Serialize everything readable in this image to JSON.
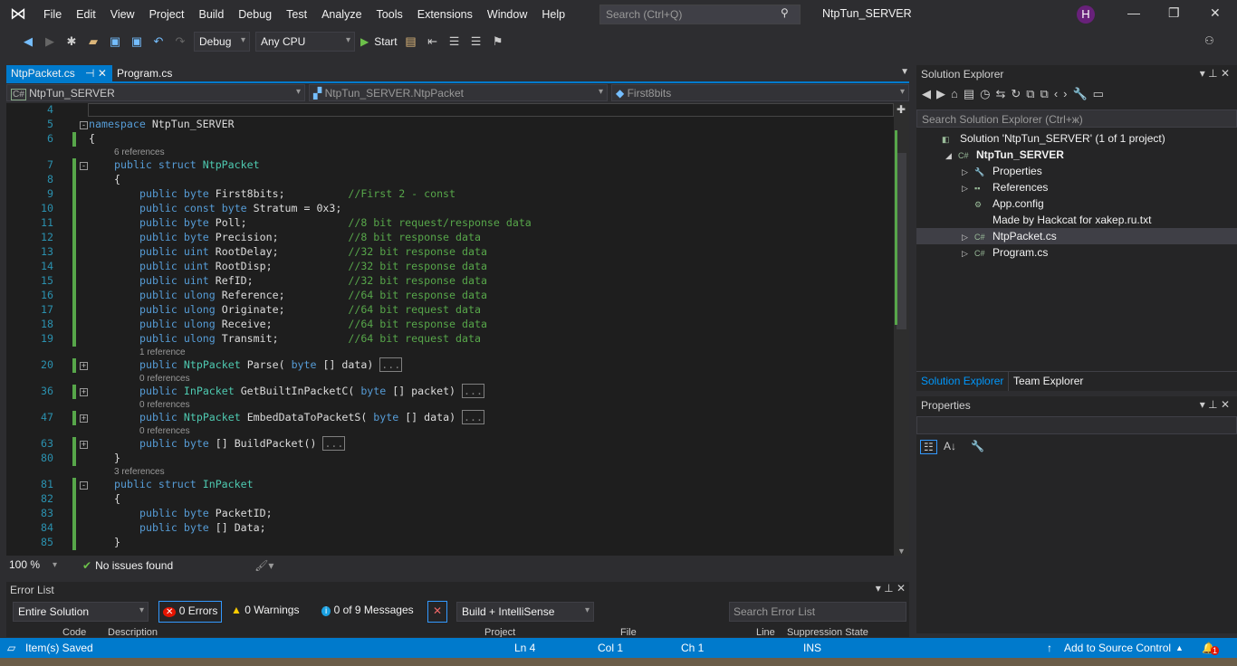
{
  "menu": {
    "items": [
      "File",
      "Edit",
      "View",
      "Project",
      "Build",
      "Debug",
      "Test",
      "Analyze",
      "Tools",
      "Extensions",
      "Window",
      "Help"
    ],
    "search_placeholder": "Search (Ctrl+Q)",
    "solution_title": "NtpTun_SERVER",
    "avatar": "H"
  },
  "toolbar": {
    "config": "Debug",
    "platform": "Any CPU",
    "start": "Start"
  },
  "tabs": [
    {
      "label": "NtpPacket.cs",
      "active": true
    },
    {
      "label": "Program.cs",
      "active": false
    }
  ],
  "navbar": {
    "project": "NtpTun_SERVER",
    "type": "NtpTun_SERVER.NtpPacket",
    "member": "First8bits"
  },
  "code": [
    {
      "n": "4",
      "i": 0,
      "t": []
    },
    {
      "n": "5",
      "i": 0,
      "fold": "-",
      "t": [
        [
          "kw",
          "namespace"
        ],
        [
          "",
          "NtpTun_SERVER"
        ]
      ]
    },
    {
      "n": "6",
      "i": 0,
      "t": [
        [
          "",
          "{"
        ]
      ]
    },
    {
      "lens": "6 references",
      "i": 1
    },
    {
      "n": "7",
      "i": 1,
      "fold": "-",
      "t": [
        [
          "kw",
          "public struct"
        ],
        [
          "ty",
          "NtpPacket"
        ]
      ]
    },
    {
      "n": "8",
      "i": 1,
      "t": [
        [
          "",
          "{"
        ]
      ]
    },
    {
      "n": "9",
      "i": 2,
      "t": [
        [
          "kw",
          "public byte"
        ],
        [
          "",
          "First8bits;         "
        ],
        [
          "cm",
          "//First 2 - const"
        ]
      ]
    },
    {
      "n": "10",
      "i": 2,
      "t": [
        [
          "kw",
          "public const byte"
        ],
        [
          "",
          "Stratum = 0x3;"
        ]
      ]
    },
    {
      "n": "11",
      "i": 2,
      "t": [
        [
          "kw",
          "public byte"
        ],
        [
          "",
          "Poll;               "
        ],
        [
          "cm",
          "//8 bit request/response data"
        ]
      ]
    },
    {
      "n": "12",
      "i": 2,
      "t": [
        [
          "kw",
          "public byte"
        ],
        [
          "",
          "Precision;          "
        ],
        [
          "cm",
          "//8 bit response data"
        ]
      ]
    },
    {
      "n": "13",
      "i": 2,
      "t": [
        [
          "kw",
          "public uint"
        ],
        [
          "",
          "RootDelay;          "
        ],
        [
          "cm",
          "//32 bit response data"
        ]
      ]
    },
    {
      "n": "14",
      "i": 2,
      "t": [
        [
          "kw",
          "public uint"
        ],
        [
          "",
          "RootDisp;           "
        ],
        [
          "cm",
          "//32 bit response data"
        ]
      ]
    },
    {
      "n": "15",
      "i": 2,
      "t": [
        [
          "kw",
          "public uint"
        ],
        [
          "",
          "RefID;              "
        ],
        [
          "cm",
          "//32 bit response data"
        ]
      ]
    },
    {
      "n": "16",
      "i": 2,
      "t": [
        [
          "kw",
          "public ulong"
        ],
        [
          "",
          "Reference;         "
        ],
        [
          "cm",
          "//64 bit response data"
        ]
      ]
    },
    {
      "n": "17",
      "i": 2,
      "t": [
        [
          "kw",
          "public ulong"
        ],
        [
          "",
          "Originate;         "
        ],
        [
          "cm",
          "//64 bit request data"
        ]
      ]
    },
    {
      "n": "18",
      "i": 2,
      "t": [
        [
          "kw",
          "public ulong"
        ],
        [
          "",
          "Receive;           "
        ],
        [
          "cm",
          "//64 bit response data"
        ]
      ]
    },
    {
      "n": "19",
      "i": 2,
      "t": [
        [
          "kw",
          "public ulong"
        ],
        [
          "",
          "Transmit;          "
        ],
        [
          "cm",
          "//64 bit request data"
        ]
      ]
    },
    {
      "lens": "1 reference",
      "i": 2
    },
    {
      "n": "20",
      "i": 2,
      "fold": "+",
      "t": [
        [
          "kw",
          "public"
        ],
        [
          "ty",
          "NtpPacket"
        ],
        [
          "",
          "Parse("
        ],
        [
          "kw",
          "byte"
        ],
        [
          "",
          "[] data)"
        ],
        [
          "col",
          "..."
        ]
      ]
    },
    {
      "lens": "0 references",
      "i": 2
    },
    {
      "n": "36",
      "i": 2,
      "fold": "+",
      "t": [
        [
          "kw",
          "public"
        ],
        [
          "ty",
          "InPacket"
        ],
        [
          "",
          "GetBuiltInPacketC("
        ],
        [
          "kw",
          "byte"
        ],
        [
          "",
          "[] packet)"
        ],
        [
          "col",
          "..."
        ]
      ]
    },
    {
      "lens": "0 references",
      "i": 2
    },
    {
      "n": "47",
      "i": 2,
      "fold": "+",
      "t": [
        [
          "kw",
          "public"
        ],
        [
          "ty",
          "NtpPacket"
        ],
        [
          "",
          "EmbedDataToPacketS("
        ],
        [
          "kw",
          "byte"
        ],
        [
          "",
          "[] data)"
        ],
        [
          "col",
          "..."
        ]
      ]
    },
    {
      "lens": "0 references",
      "i": 2
    },
    {
      "n": "63",
      "i": 2,
      "fold": "+",
      "t": [
        [
          "kw",
          "public byte"
        ],
        [
          "",
          "[] BuildPacket()"
        ],
        [
          "col",
          "..."
        ]
      ]
    },
    {
      "n": "80",
      "i": 1,
      "t": [
        [
          "",
          "}"
        ]
      ]
    },
    {
      "lens": "3 references",
      "i": 1
    },
    {
      "n": "81",
      "i": 1,
      "fold": "-",
      "t": [
        [
          "kw",
          "public struct"
        ],
        [
          "ty",
          "InPacket"
        ]
      ]
    },
    {
      "n": "82",
      "i": 1,
      "t": [
        [
          "",
          "{"
        ]
      ]
    },
    {
      "n": "83",
      "i": 2,
      "t": [
        [
          "kw",
          "public byte"
        ],
        [
          "",
          "PacketID;"
        ]
      ]
    },
    {
      "n": "84",
      "i": 2,
      "t": [
        [
          "kw",
          "public byte"
        ],
        [
          "",
          "[] Data;"
        ]
      ]
    },
    {
      "n": "85",
      "i": 1,
      "t": [
        [
          "",
          "}"
        ]
      ]
    }
  ],
  "editor_status": {
    "zoom": "100 %",
    "issues": "No issues found"
  },
  "error_list": {
    "title": "Error List",
    "scope": "Entire Solution",
    "errors": "0 Errors",
    "warnings": "0 Warnings",
    "messages": "0 of 9 Messages",
    "filter": "Build + IntelliSense",
    "search_placeholder": "Search Error List",
    "columns": [
      "Code",
      "Description",
      "Project",
      "File",
      "Line",
      "Suppression State"
    ]
  },
  "status": {
    "message": "Item(s) Saved",
    "ln": "Ln 4",
    "col": "Col 1",
    "ch": "Ch 1",
    "mode": "INS",
    "source_control": "Add to Source Control",
    "notifications": "1"
  },
  "solution_explorer": {
    "title": "Solution Explorer",
    "search_placeholder": "Search Solution Explorer (Ctrl+ж)",
    "items": [
      {
        "label": "Solution 'NtpTun_SERVER' (1 of 1 project)",
        "level": 0,
        "icon": "solution-icon"
      },
      {
        "label": "NtpTun_SERVER",
        "level": 1,
        "icon": "csharp-project-icon",
        "bold": true,
        "expanded": true
      },
      {
        "label": "Properties",
        "level": 2,
        "icon": "wrench-icon",
        "arrow": true
      },
      {
        "label": "References",
        "level": 2,
        "icon": "references-icon",
        "arrow": true
      },
      {
        "label": "App.config",
        "level": 2,
        "icon": "config-icon"
      },
      {
        "label": "Made by Hackcat for xakep.ru.txt",
        "level": 2,
        "icon": "text-file-icon"
      },
      {
        "label": "NtpPacket.cs",
        "level": 2,
        "icon": "csharp-file-icon",
        "arrow": true,
        "selected": true
      },
      {
        "label": "Program.cs",
        "level": 2,
        "icon": "csharp-file-icon",
        "arrow": true
      }
    ],
    "tabs": [
      "Solution Explorer",
      "Team Explorer"
    ]
  },
  "properties": {
    "title": "Properties"
  }
}
